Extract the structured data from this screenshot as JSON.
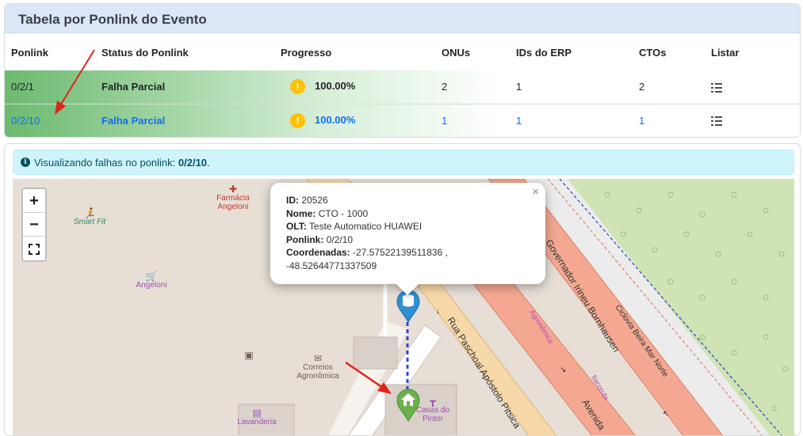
{
  "table_card": {
    "title": "Tabela por Ponlink do Evento",
    "columns": [
      "Ponlink",
      "Status do Ponlink",
      "Progresso",
      "ONUs",
      "IDs do ERP",
      "CTOs",
      "Listar"
    ],
    "rows": [
      {
        "ponlink": "0/2/1",
        "status": "Falha Parcial",
        "progress": "100.00%",
        "onus": "2",
        "erp": "1",
        "ctos": "2"
      },
      {
        "ponlink": "0/2/10",
        "status": "Falha Parcial",
        "progress": "100.00%",
        "onus": "1",
        "erp": "1",
        "ctos": "1"
      }
    ]
  },
  "alert": {
    "text": "Visualizando falhas no ponlink: ",
    "ponlink": "0/2/10",
    "suffix": "."
  },
  "map": {
    "zoom_in": "+",
    "zoom_out": "−",
    "popup": {
      "id_label": "ID:",
      "id_value": "20526",
      "nome_label": "Nome:",
      "nome_value": "CTO - 1000",
      "olt_label": "OLT:",
      "olt_value": "Teste Automatico HUAWEI",
      "ponlink_label": "Ponlink:",
      "ponlink_value": "0/2/10",
      "coord_label": "Coordenadas:",
      "coord_value_1": "-27.57522139511836 ,",
      "coord_value_2": "-48.52644771337509",
      "close": "×"
    },
    "labels": {
      "farmacia_1": "Farmácia",
      "farmacia_2": "Angeloni",
      "smartfit": "Smart Fit",
      "angeloni": "Angeloni",
      "correios_1": "Correios",
      "correios_2": "Agronômica",
      "lavanderia": "Lavanderia",
      "casas_1": "Casas do",
      "casas_2": "Pintor",
      "rua_paschoal": "Rua Paschoal Apóstolo Pitsica",
      "governador": "Governador Irineu Bornhausen",
      "ciclovia": "Ciclovia Beira Mar Norte",
      "agronomica": "Agronômica",
      "itacorubi": "Itacorubi",
      "avenida": "Avenida"
    },
    "colors": {
      "primary_road": "#f4a891",
      "secondary_road": "#f7d8a8",
      "park": "#c9dfb0",
      "cto_marker": "#2f8fd1",
      "house_marker": "#6ab04c",
      "arrow": "#e0241b"
    }
  }
}
